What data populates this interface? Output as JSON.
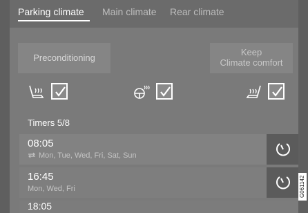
{
  "tabs": [
    {
      "label": "Parking climate",
      "active": true
    },
    {
      "label": "Main climate",
      "active": false
    },
    {
      "label": "Rear climate",
      "active": false
    }
  ],
  "buttons": {
    "preconditioning": "Preconditioning",
    "keep_climate_line1": "Keep",
    "keep_climate_line2": "Climate comfort"
  },
  "seats": [
    {
      "icon": "heated-seat-icon",
      "checked": true
    },
    {
      "icon": "heated-steering-wheel-icon",
      "checked": true
    },
    {
      "icon": "ventilated-seat-icon",
      "checked": true
    }
  ],
  "timers_label": "Timers 5/8",
  "timers": [
    {
      "time": "08:05",
      "days": "Mon, Tue, Wed, Fri, Sat, Sun",
      "repeat": true
    },
    {
      "time": "16:45",
      "days": "Mon, Wed, Fri",
      "repeat": false
    },
    {
      "time": "18:05",
      "days": "",
      "repeat": false
    }
  ],
  "reference_code": "G061142",
  "colors": {
    "background": "#7a7a7a",
    "tab_bar": "#6b6b6b",
    "timer_button": "#5b5b5b"
  }
}
